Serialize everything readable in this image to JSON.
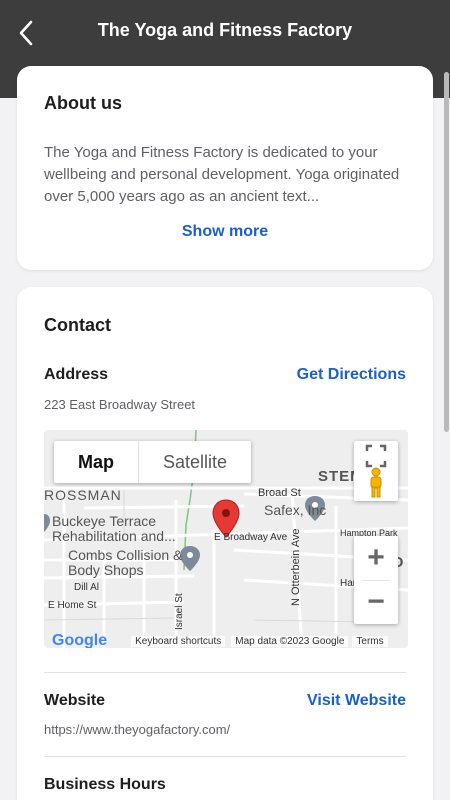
{
  "header": {
    "title": "The Yoga and Fitness Factory",
    "back_icon": "chevron-left-icon"
  },
  "about": {
    "title": "About us",
    "text": "The Yoga and Fitness Factory is dedicated to your wellbeing and personal development. Yoga originated over 5,000 years ago as an ancient text...",
    "show_more": "Show more"
  },
  "contact": {
    "title": "Contact",
    "address": {
      "label": "Address",
      "action": "Get Directions",
      "value": "223 East Broadway Street"
    },
    "map": {
      "tab_map": "Map",
      "tab_satellite": "Satellite",
      "zoom_in": "+",
      "zoom_out": "−",
      "labels": {
        "stems": "STEMS",
        "rossman": "ROSSMAN",
        "broad_st": "Broad St",
        "safex": "Safex, Inc",
        "hampton_park": "Hampton Park",
        "buckeye": "Buckeye Terrace Rehabilitation and...",
        "broadway_ave": "E Broadway Ave",
        "otterbein": "N Otterbein Ave",
        "hampton": "Hampto",
        "hto": "HTO",
        "combs": "Combs Collision & Body Shops",
        "dill": "Dill Al",
        "home_st": "E Home St",
        "israel": "Israel St"
      },
      "footer": {
        "logo": "Google",
        "shortcuts": "Keyboard shortcuts",
        "data": "Map data ©2023 Google",
        "terms": "Terms"
      }
    },
    "website": {
      "label": "Website",
      "action": "Visit Website",
      "value": "https://www.theyogafactory.com/"
    },
    "hours": {
      "label": "Business Hours"
    }
  },
  "colors": {
    "accent": "#1a5fcc",
    "header": "#3d3d3d",
    "pin": "#e53935"
  }
}
